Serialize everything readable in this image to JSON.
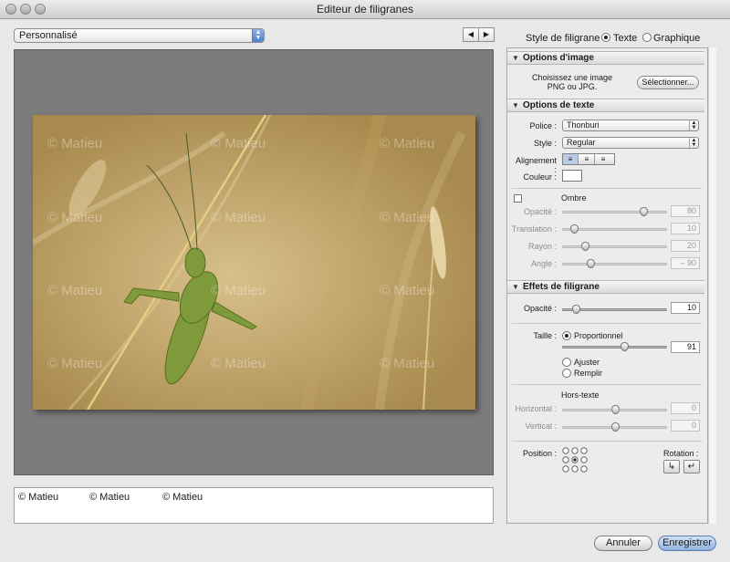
{
  "window": {
    "title": "Editeur de filigranes"
  },
  "preset": {
    "selected": "Personnalisé"
  },
  "nav": {
    "prev": "◀",
    "next": "▶"
  },
  "style": {
    "label": "Style de filigrane :",
    "texte": "Texte",
    "graphique": "Graphique",
    "selected": "Texte"
  },
  "preview": {
    "watermark_text": "© Matieu"
  },
  "text_input": {
    "items": [
      "© Matieu",
      "© Matieu",
      "© Matieu"
    ]
  },
  "image_options": {
    "header": "Options d'image",
    "prompt_line1": "Choisissez une image",
    "prompt_line2": "PNG ou JPG.",
    "select_button": "Sélectionner..."
  },
  "text_options": {
    "header": "Options de texte",
    "police_label": "Police :",
    "police_value": "Thonburi",
    "style_label": "Style :",
    "style_value": "Regular",
    "alignment_label": "Alignement :",
    "color_label": "Couleur :",
    "shadow_label": "Ombre",
    "shadow_checked": false,
    "opacity_label": "Opacité :",
    "opacity_value": "80",
    "translation_label": "Translation :",
    "translation_value": "10",
    "rayon_label": "Rayon :",
    "rayon_value": "20",
    "angle_label": "Angle :",
    "angle_value": "– 90"
  },
  "effects": {
    "header": "Effets de filigrane",
    "opacity_label": "Opacité :",
    "opacity_value": "10",
    "taille_label": "Taille :",
    "proportionnel": "Proportionnel",
    "taille_value": "91",
    "ajuster": "Ajuster",
    "remplir": "Remplir",
    "taille_selected": "Proportionnel",
    "hors_texte_label": "Hors-texte",
    "horizontal_label": "Horizontal :",
    "horizontal_value": "0",
    "vertical_label": "Vertical :",
    "vertical_value": "0",
    "position_label": "Position :",
    "rotation_label": "Rotation :",
    "rotate_left": "↳",
    "rotate_right": "↵"
  },
  "footer": {
    "cancel": "Annuler",
    "save": "Enregistrer"
  },
  "colors": {
    "accent": "#4d7fd0",
    "preview_bg": "#7c7c7c"
  }
}
